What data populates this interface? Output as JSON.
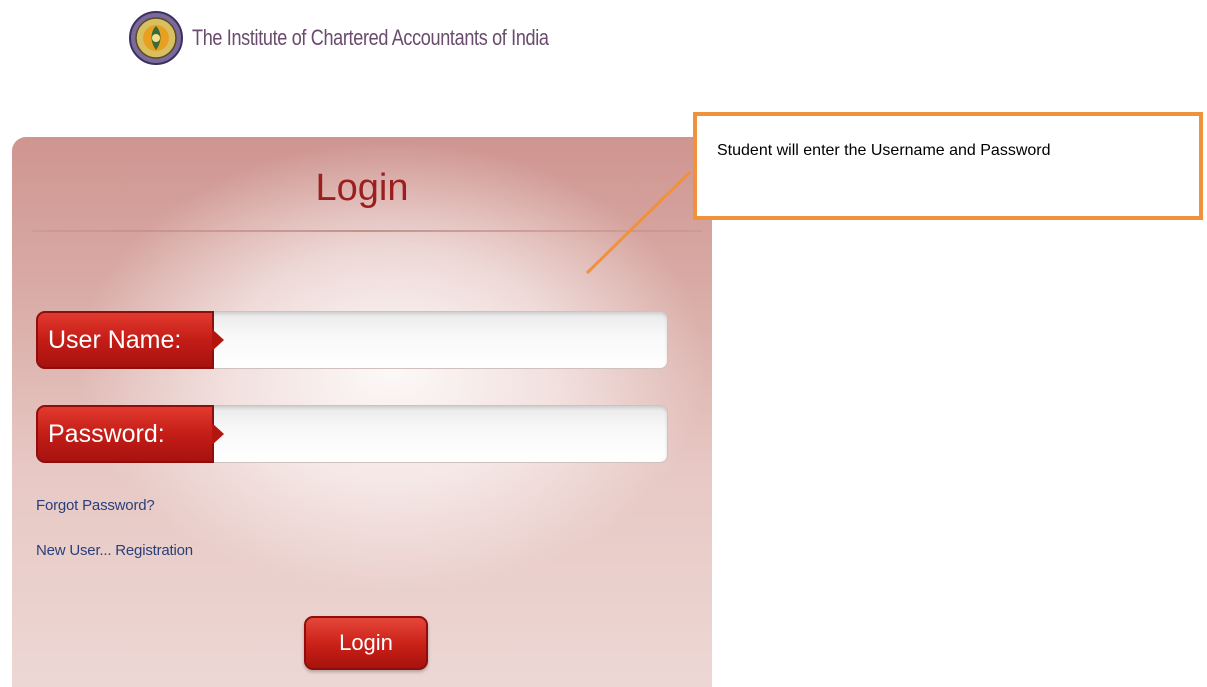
{
  "header": {
    "institute_name": "The Institute of Chartered Accountants of India",
    "logo_icon": "icai-emblem-icon"
  },
  "login_panel": {
    "title": "Login",
    "username_label": "User Name:",
    "username_value": "",
    "password_label": "Password:",
    "password_value": "",
    "forgot_password_link": "Forgot Password?",
    "registration_link": "New User... Registration",
    "login_button": "Login"
  },
  "annotation": {
    "text": "Student will enter the Username and Password"
  },
  "colors": {
    "brand_red": "#c41d17",
    "link_blue": "#2a3f7a",
    "callout_orange": "#f0913d",
    "title_red": "#9b1f1f"
  }
}
